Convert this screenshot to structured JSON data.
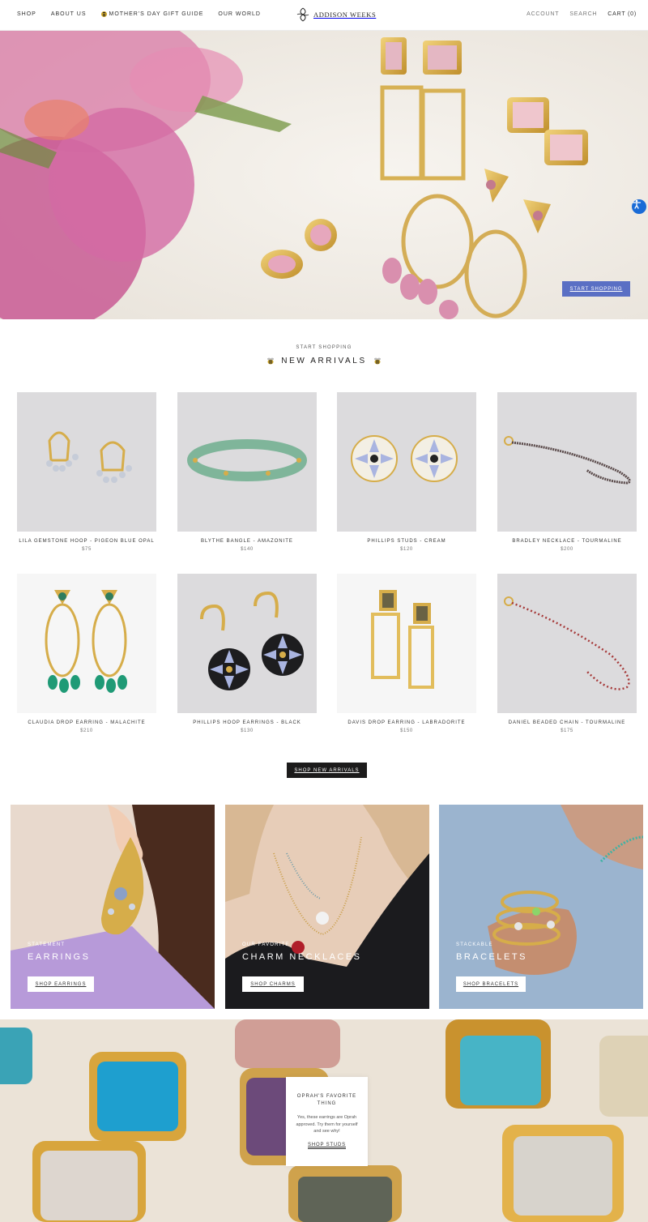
{
  "header": {
    "nav_left": [
      "SHOP",
      "ABOUT US",
      "MOTHER'S DAY GIFT GUIDE",
      "OUR WORLD"
    ],
    "logo_text": "ADDISON WEEKS",
    "nav_right": {
      "account": "ACCOUNT",
      "search": "SEARCH",
      "cart": "CART (0)"
    }
  },
  "hero": {
    "button": "START SHOPPING"
  },
  "new_arrivals": {
    "eyebrow": "START SHOPPING",
    "title": "NEW ARRIVALS",
    "products": [
      {
        "name": "LILA GEMSTONE HOOP - PIGEON BLUE OPAL",
        "price": "$75"
      },
      {
        "name": "BLYTHE BANGLE - AMAZONITE",
        "price": "$140"
      },
      {
        "name": "PHILLIPS STUDS - CREAM",
        "price": "$120"
      },
      {
        "name": "BRADLEY NECKLACE - TOURMALINE",
        "price": "$200"
      },
      {
        "name": "CLAUDIA DROP EARRING - MALACHITE",
        "price": "$210"
      },
      {
        "name": "PHILLIPS HOOP EARRINGS - BLACK",
        "price": "$130"
      },
      {
        "name": "DAVIS DROP EARRING - LABRADORITE",
        "price": "$150"
      },
      {
        "name": "DANIEL BEADED CHAIN - TOURMALINE",
        "price": "$175"
      }
    ],
    "button": "SHOP NEW ARRIVALS"
  },
  "categories": [
    {
      "sub": "STATEMENT",
      "title": "EARRINGS",
      "button": "SHOP EARRINGS"
    },
    {
      "sub": "OUR FAVORITE",
      "title": "CHARM NECKLACES",
      "button": "SHOP CHARMS"
    },
    {
      "sub": "STACKABLE",
      "title": "BRACELETS",
      "button": "SHOP BRACELETS"
    }
  ],
  "oprah": {
    "title": "OPRAH'S FAVORITE THING",
    "description": "Yes, these earrings are Oprah approved. Try them for yourself and see why!",
    "link": "SHOP STUDS"
  },
  "colors": {
    "accent_button": "#5a6fc4",
    "dark_button": "#1c1b1b",
    "accessibility": "#1a6bd6"
  }
}
